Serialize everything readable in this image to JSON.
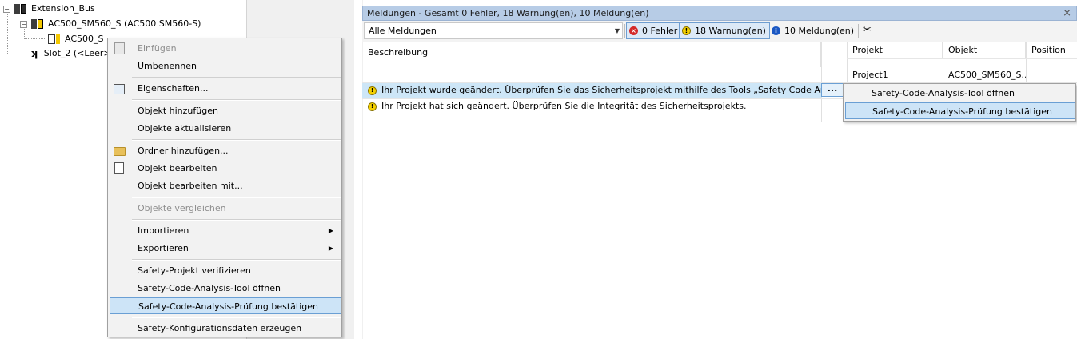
{
  "tree": {
    "items": [
      {
        "label": "Extension_Bus"
      },
      {
        "label": "AC500_SM560_S (AC500 SM560-S)"
      },
      {
        "label": "AC500_S"
      },
      {
        "label": "Slot_2 (<Leer>"
      }
    ],
    "expander_symbol": "−"
  },
  "context_menu": {
    "items": [
      {
        "label": "Einfügen",
        "disabled": true,
        "icon": "paste-icon"
      },
      {
        "label": "Umbenennen"
      },
      {
        "label": "Eigenschaften...",
        "icon": "properties-icon"
      },
      {
        "label": "Objekt hinzufügen"
      },
      {
        "label": "Objekte aktualisieren"
      },
      {
        "label": "Ordner hinzufügen...",
        "icon": "folder-icon"
      },
      {
        "label": "Objekt bearbeiten",
        "icon": "edit-object-icon"
      },
      {
        "label": "Objekt bearbeiten mit..."
      },
      {
        "label": "Objekte vergleichen",
        "disabled": true
      },
      {
        "label": "Importieren",
        "submenu": true
      },
      {
        "label": "Exportieren",
        "submenu": true
      },
      {
        "label": "Safety-Projekt verifizieren"
      },
      {
        "label": "Safety-Code-Analysis-Tool öffnen"
      },
      {
        "label": "Safety-Code-Analysis-Prüfung bestätigen",
        "highlighted": true
      },
      {
        "label": "Safety-Konfigurationsdaten erzeugen"
      }
    ],
    "submenu_arrow": "▶"
  },
  "messages": {
    "title": "Meldungen - Gesamt 0 Fehler, 18 Warnung(en), 10 Meldung(en)",
    "close_glyph": "×",
    "filter_value": "Alle Meldungen",
    "dropdown_glyph": "▼",
    "errors_label": "0 Fehler",
    "warnings_label": "18 Warnung(en)",
    "infos_label": "10 Meldung(en)",
    "columns": {
      "description": "Beschreibung",
      "project": "Projekt",
      "object": "Objekt",
      "position": "Position"
    },
    "rows": [
      {
        "project": "Project1",
        "object": "AC500_SM560_S...",
        "description": ""
      },
      {
        "description": "Ihr Projekt wurde geändert. Überprüfen Sie das Sicherheitsprojekt mithilfe des Tools „Safety Code Analysis“."
      },
      {
        "description": "Ihr Projekt hat sich geändert. Überprüfen Sie die Integrität des Sicherheitsprojekts."
      }
    ],
    "row_button": "...",
    "status_colors": {
      "error": "#d42a2a",
      "warning": "#f4d000",
      "info": "#1a57c3"
    }
  },
  "row_popup": {
    "items": [
      {
        "label": "Safety-Code-Analysis-Tool öffnen"
      },
      {
        "label": "Safety-Code-Analysis-Prüfung bestätigen",
        "highlighted": true
      }
    ]
  }
}
